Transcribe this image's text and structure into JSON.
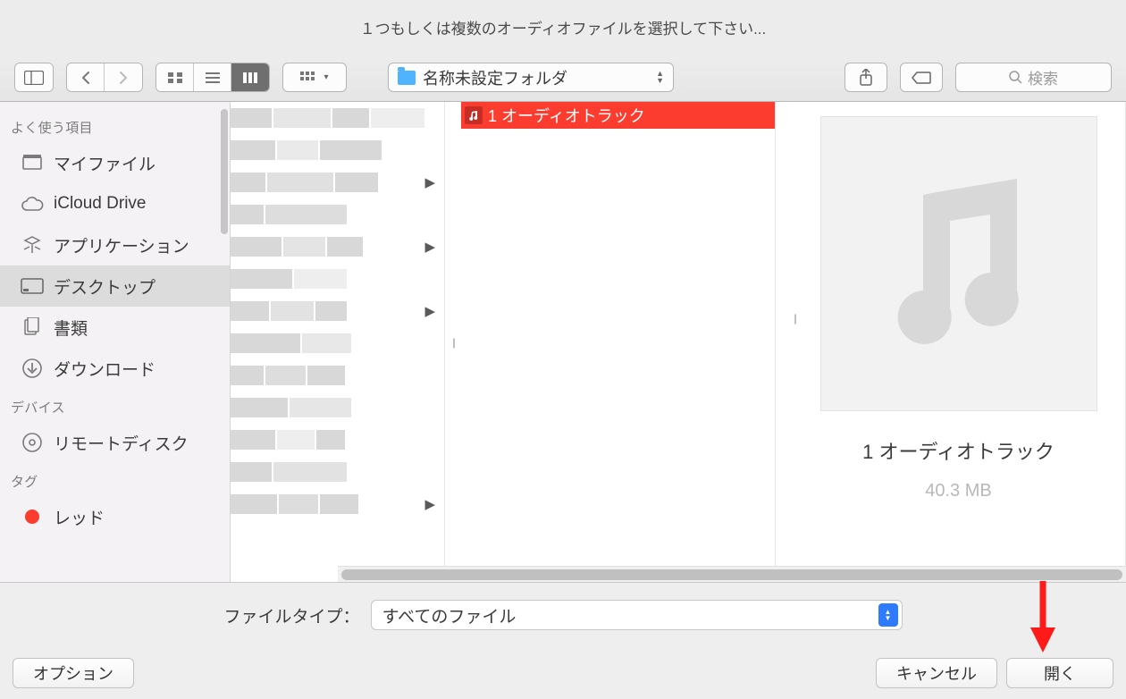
{
  "title": "１つもしくは複数のオーディオファイルを選択して下さい...",
  "toolbar": {
    "path_folder": "名称未設定フォルダ",
    "search_placeholder": "検索"
  },
  "sidebar": {
    "favorites_header": "よく使う項目",
    "devices_header": "デバイス",
    "tags_header": "タグ",
    "items": {
      "myfiles": "マイファイル",
      "icloud": "iCloud Drive",
      "applications": "アプリケーション",
      "desktop": "デスクトップ",
      "documents": "書類",
      "downloads": "ダウンロード",
      "remotedisc": "リモートディスク",
      "tag_red": "レッド"
    }
  },
  "file_list": {
    "selected_file": "1 オーディオトラック"
  },
  "preview": {
    "filename": "1 オーディオトラック",
    "size": "40.3 MB"
  },
  "filetype": {
    "label": "ファイルタイプ：",
    "value": "すべてのファイル"
  },
  "buttons": {
    "options": "オプション",
    "cancel": "キャンセル",
    "open": "開く"
  },
  "colors": {
    "tag_red": "#fb3c2f"
  }
}
